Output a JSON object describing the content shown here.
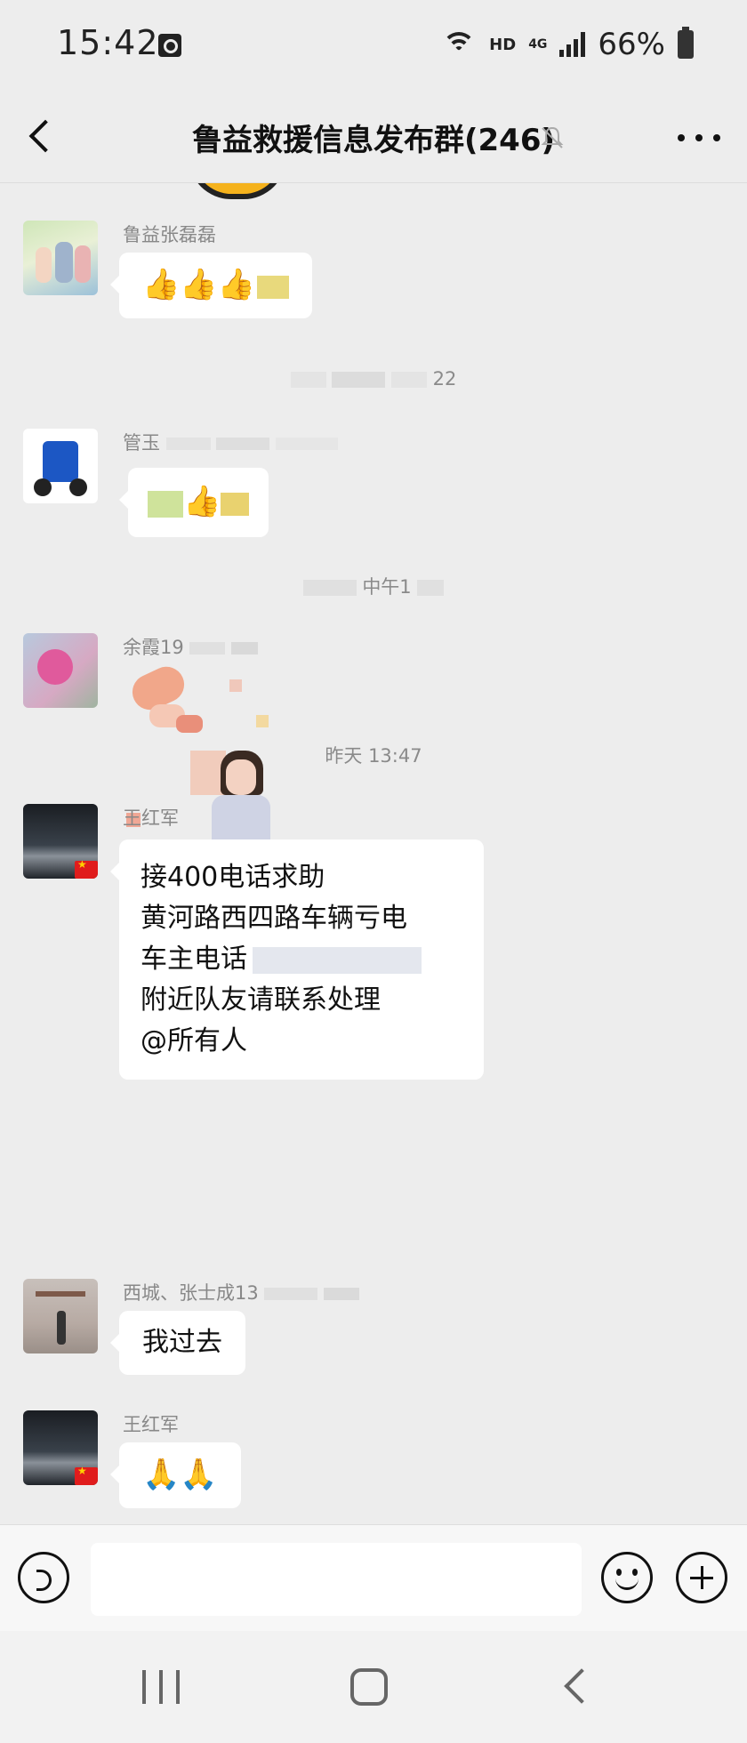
{
  "status_bar": {
    "time": "15:42",
    "hd": "HD",
    "network": "4G",
    "battery": "66%"
  },
  "header": {
    "title": "鲁益救援信息发布群(246)"
  },
  "messages": [
    {
      "sender": "鲁益张磊磊",
      "text": "👍👍👍"
    },
    {
      "time": "22"
    },
    {
      "sender": "管玉",
      "text": "👍"
    },
    {
      "time": "中午1"
    },
    {
      "sender": "余霞19"
    },
    {
      "time": "昨天 13:47"
    },
    {
      "sender": "王红军",
      "lines": [
        "接400电话求助",
        "黄河路西四路车辆亏电",
        "车主电话",
        "附近队友请联系处理",
        "@所有人"
      ]
    },
    {
      "sender": "西城、张士成13",
      "text": "我过去"
    },
    {
      "sender": "王红军",
      "text": "🙏🙏"
    }
  ],
  "input": {
    "placeholder": ""
  },
  "colors": {
    "background": "#ededed",
    "bubble": "#ffffff",
    "flag": "#e01c1c"
  }
}
